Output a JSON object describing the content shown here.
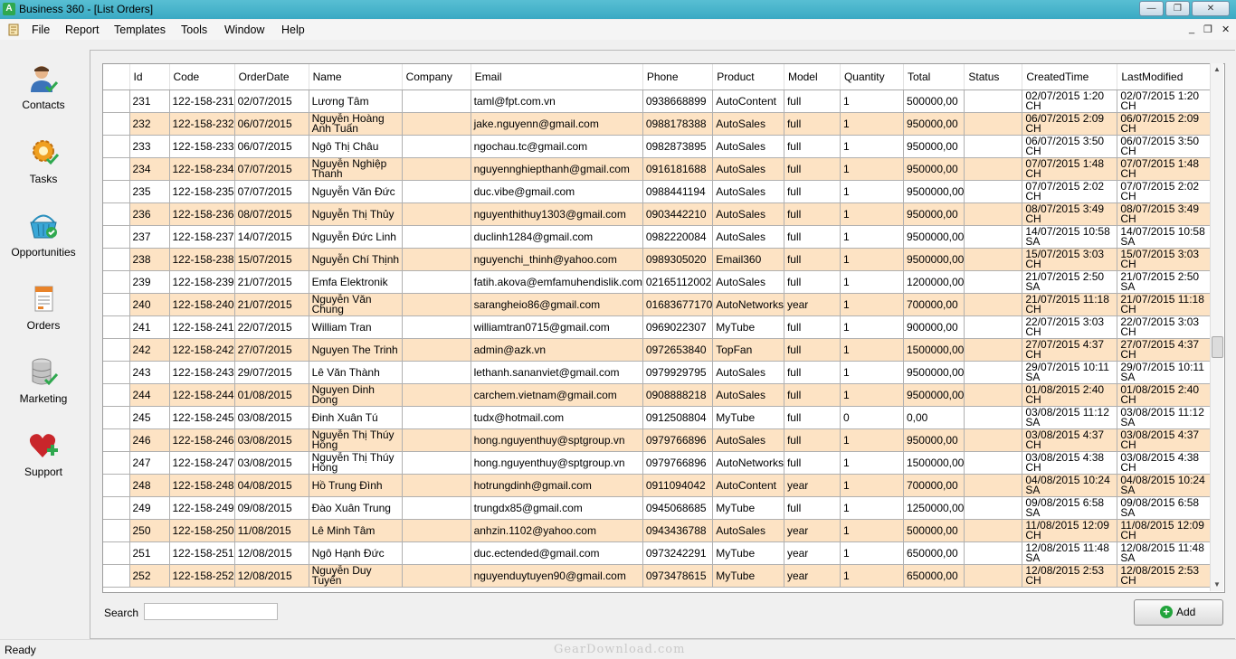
{
  "window": {
    "title": "Business 360 - [List Orders]",
    "app_icon_letter": "A",
    "minimize_glyph": "—",
    "maximize_glyph": "❐",
    "close_glyph": "✕"
  },
  "menu": {
    "items": [
      "File",
      "Report",
      "Templates",
      "Tools",
      "Window",
      "Help"
    ],
    "mdi_minimize": "_",
    "mdi_restore": "❐",
    "mdi_close": "✕"
  },
  "sidebar": {
    "items": [
      {
        "label": "Contacts",
        "icon": "person-icon"
      },
      {
        "label": "Tasks",
        "icon": "gear-icon"
      },
      {
        "label": "Opportunities",
        "icon": "basket-icon"
      },
      {
        "label": "Orders",
        "icon": "order-document-icon"
      },
      {
        "label": "Marketing",
        "icon": "database-icon"
      },
      {
        "label": "Support",
        "icon": "heart-plus-icon"
      }
    ]
  },
  "grid": {
    "columns": [
      "Id",
      "Code",
      "OrderDate",
      "Name",
      "Company",
      "Email",
      "Phone",
      "Product",
      "Model",
      "Quantity",
      "Total",
      "Status",
      "CreatedTime",
      "LastModified"
    ],
    "rows": [
      [
        "231",
        "122-158-231",
        "02/07/2015",
        "Lương Tâm",
        "",
        "taml@fpt.com.vn",
        "0938668899",
        "AutoContent",
        "full",
        "1",
        "500000,00",
        "",
        "02/07/2015 1:20 CH",
        "02/07/2015 1:20 CH"
      ],
      [
        "232",
        "122-158-232",
        "06/07/2015",
        "Nguyễn Hoàng Anh Tuấn",
        "",
        "jake.nguyenn@gmail.com",
        "0988178388",
        "AutoSales",
        "full",
        "1",
        "950000,00",
        "",
        "06/07/2015 2:09 CH",
        "06/07/2015 2:09 CH"
      ],
      [
        "233",
        "122-158-233",
        "06/07/2015",
        "Ngô Thị Châu",
        "",
        "ngochau.tc@gmail.com",
        "0982873895",
        "AutoSales",
        "full",
        "1",
        "950000,00",
        "",
        "06/07/2015 3:50 CH",
        "06/07/2015 3:50 CH"
      ],
      [
        "234",
        "122-158-234",
        "07/07/2015",
        "Nguyễn Nghiệp Thanh",
        "",
        "nguyennghiepthanh@gmail.com",
        "0916181688",
        "AutoSales",
        "full",
        "1",
        "950000,00",
        "",
        "07/07/2015 1:48 CH",
        "07/07/2015 1:48 CH"
      ],
      [
        "235",
        "122-158-235",
        "07/07/2015",
        "Nguyễn Văn Đức",
        "",
        "duc.vibe@gmail.com",
        "0988441194",
        "AutoSales",
        "full",
        "1",
        "9500000,00",
        "",
        "07/07/2015 2:02 CH",
        "07/07/2015 2:02 CH"
      ],
      [
        "236",
        "122-158-236",
        "08/07/2015",
        "Nguyễn Thị Thủy",
        "",
        "nguyenthithuy1303@gmail.com",
        "0903442210",
        "AutoSales",
        "full",
        "1",
        "950000,00",
        "",
        "08/07/2015 3:49 CH",
        "08/07/2015 3:49 CH"
      ],
      [
        "237",
        "122-158-237",
        "14/07/2015",
        "Nguyễn Đức Linh",
        "",
        "duclinh1284@gmail.com",
        "0982220084",
        "AutoSales",
        "full",
        "1",
        "9500000,00",
        "",
        "14/07/2015 10:58 SA",
        "14/07/2015 10:58 SA"
      ],
      [
        "238",
        "122-158-238",
        "15/07/2015",
        "Nguyễn Chí Thịnh",
        "",
        "nguyenchi_thinh@yahoo.com",
        "0989305020",
        "Email360",
        "full",
        "1",
        "9500000,00",
        "",
        "15/07/2015 3:03 CH",
        "15/07/2015 3:03 CH"
      ],
      [
        "239",
        "122-158-239",
        "21/07/2015",
        "Emfa Elektronik",
        "",
        "fatih.akova@emfamuhendislik.com",
        "02165112002",
        "AutoSales",
        "full",
        "1",
        "1200000,00",
        "",
        "21/07/2015 2:50 SA",
        "21/07/2015 2:50 SA"
      ],
      [
        "240",
        "122-158-240",
        "21/07/2015",
        "Nguyễn Văn Chung",
        "",
        "sarangheio86@gmail.com",
        "01683677170",
        "AutoNetworks",
        "year",
        "1",
        "700000,00",
        "",
        "21/07/2015 11:18 CH",
        "21/07/2015 11:18 CH"
      ],
      [
        "241",
        "122-158-241",
        "22/07/2015",
        "William Tran",
        "",
        "williamtran0715@gmail.com",
        "0969022307",
        "MyTube",
        "full",
        "1",
        "900000,00",
        "",
        "22/07/2015 3:03 CH",
        "22/07/2015 3:03 CH"
      ],
      [
        "242",
        "122-158-242",
        "27/07/2015",
        "Nguyen The Trinh",
        "",
        "admin@azk.vn",
        "0972653840",
        "TopFan",
        "full",
        "1",
        "1500000,00",
        "",
        "27/07/2015 4:37 CH",
        "27/07/2015 4:37 CH"
      ],
      [
        "243",
        "122-158-243",
        "29/07/2015",
        "Lê Văn Thành",
        "",
        "lethanh.sananviet@gmail.com",
        "0979929795",
        "AutoSales",
        "full",
        "1",
        "9500000,00",
        "",
        "29/07/2015 10:11 SA",
        "29/07/2015 10:11 SA"
      ],
      [
        "244",
        "122-158-244",
        "01/08/2015",
        "Nguyen Dinh Dong",
        "",
        "carchem.vietnam@gmail.com",
        "0908888218",
        "AutoSales",
        "full",
        "1",
        "9500000,00",
        "",
        "01/08/2015 2:40 CH",
        "01/08/2015 2:40 CH"
      ],
      [
        "245",
        "122-158-245",
        "03/08/2015",
        "Đinh Xuân Tú",
        "",
        "tudx@hotmail.com",
        "0912508804",
        "MyTube",
        "full",
        "0",
        "0,00",
        "",
        "03/08/2015 11:12 SA",
        "03/08/2015 11:12 SA"
      ],
      [
        "246",
        "122-158-246",
        "03/08/2015",
        "Nguyễn Thị Thúy Hồng",
        "",
        "hong.nguyenthuy@sptgroup.vn",
        "0979766896",
        "AutoSales",
        "full",
        "1",
        "950000,00",
        "",
        "03/08/2015 4:37 CH",
        "03/08/2015 4:37 CH"
      ],
      [
        "247",
        "122-158-247",
        "03/08/2015",
        "Nguyễn Thị Thúy Hồng",
        "",
        "hong.nguyenthuy@sptgroup.vn",
        "0979766896",
        "AutoNetworks",
        "full",
        "1",
        "1500000,00",
        "",
        "03/08/2015 4:38 CH",
        "03/08/2015 4:38 CH"
      ],
      [
        "248",
        "122-158-248",
        "04/08/2015",
        "Hồ Trung Đình",
        "",
        "hotrungdinh@gmail.com",
        "0911094042",
        "AutoContent",
        "year",
        "1",
        "700000,00",
        "",
        "04/08/2015 10:24 SA",
        "04/08/2015 10:24 SA"
      ],
      [
        "249",
        "122-158-249",
        "09/08/2015",
        "Đào Xuân Trung",
        "",
        "trungdx85@gmail.com",
        "0945068685",
        "MyTube",
        "full",
        "1",
        "1250000,00",
        "",
        "09/08/2015 6:58 SA",
        "09/08/2015 6:58 SA"
      ],
      [
        "250",
        "122-158-250",
        "11/08/2015",
        "Lê Minh Tâm",
        "",
        "anhzin.1102@yahoo.com",
        "0943436788",
        "AutoSales",
        "year",
        "1",
        "500000,00",
        "",
        "11/08/2015 12:09 CH",
        "11/08/2015 12:09 CH"
      ],
      [
        "251",
        "122-158-251",
        "12/08/2015",
        "Ngô Hạnh Đức",
        "",
        "duc.ectended@gmail.com",
        "0973242291",
        "MyTube",
        "year",
        "1",
        "650000,00",
        "",
        "12/08/2015 11:48 SA",
        "12/08/2015 11:48 SA"
      ],
      [
        "252",
        "122-158-252",
        "12/08/2015",
        "Nguyễn Duy Tuyến",
        "",
        "nguyenduytuyen90@gmail.com",
        "0973478615",
        "MyTube",
        "year",
        "1",
        "650000,00",
        "",
        "12/08/2015 2:53 CH",
        "12/08/2015 2:53 CH"
      ]
    ]
  },
  "search": {
    "label": "Search",
    "value": ""
  },
  "add_button": {
    "label": "Add",
    "icon": "plus-circle-icon"
  },
  "status": {
    "text": "Ready"
  },
  "watermark": {
    "text": "GearDownload.com"
  },
  "colors": {
    "alt_row": "#fde3c4",
    "titlebar": "#3aa9c3"
  }
}
